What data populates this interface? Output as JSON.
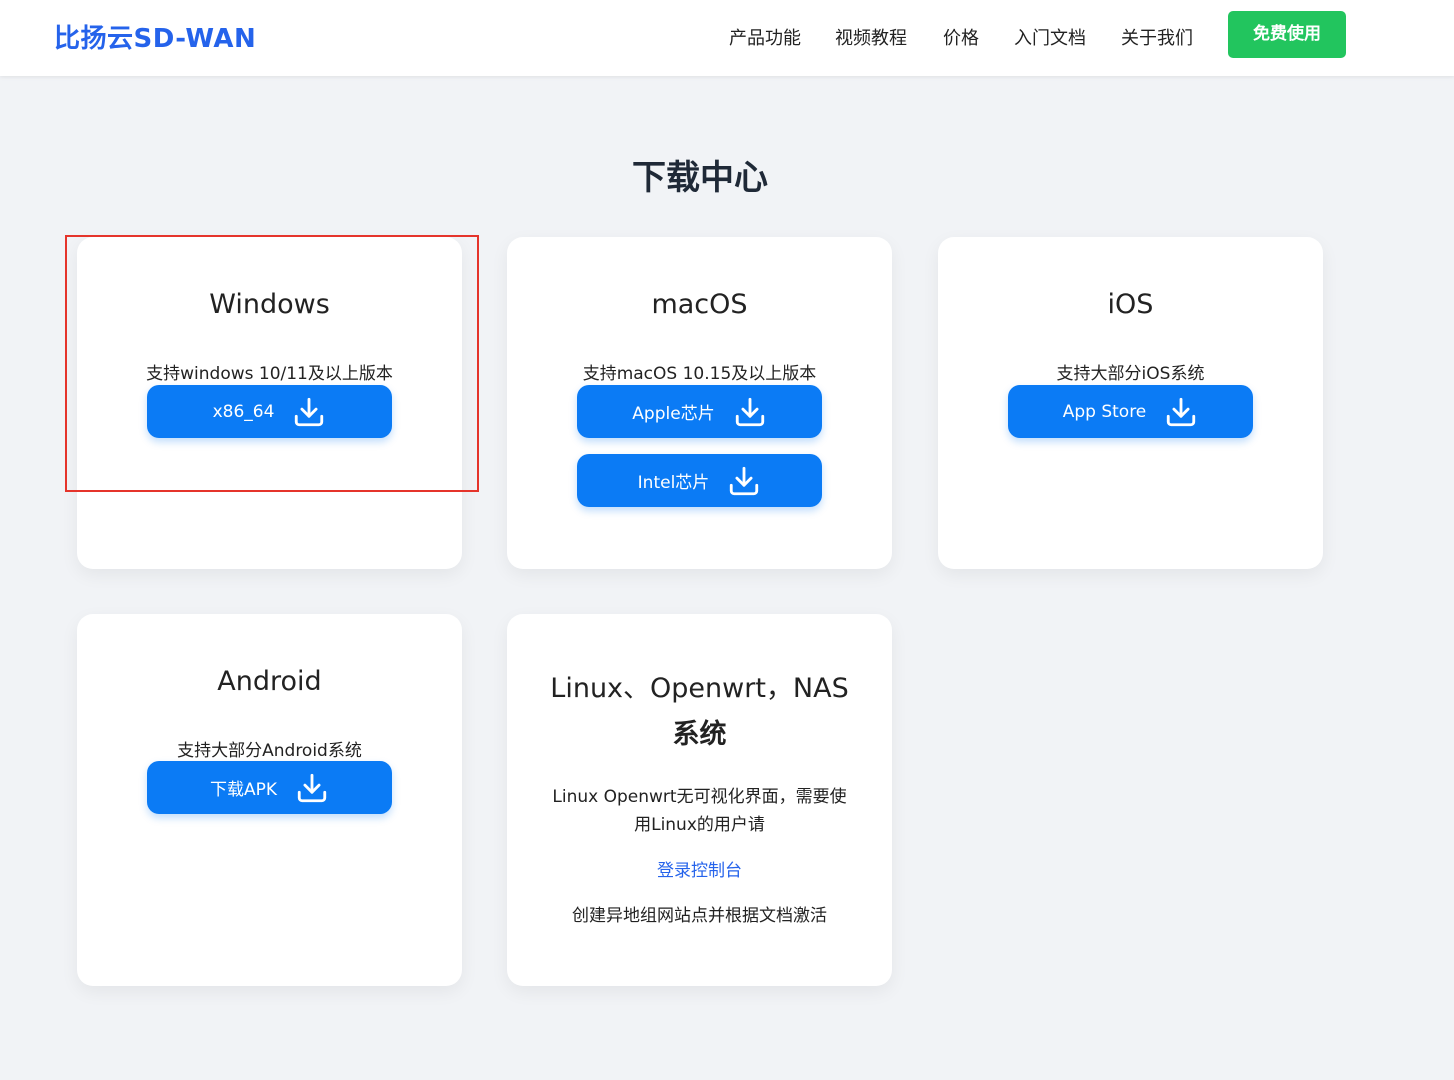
{
  "header": {
    "logo": "比扬云SD-WAN",
    "nav": [
      "产品功能",
      "视频教程",
      "价格",
      "入门文档",
      "关于我们"
    ],
    "cta": "免费使用"
  },
  "main": {
    "title": "下载中心",
    "cards": {
      "windows": {
        "title": "Windows",
        "desc": "支持windows 10/11及以上版本",
        "buttons": [
          "x86_64"
        ]
      },
      "macos": {
        "title": "macOS",
        "desc": "支持macOS 10.15及以上版本",
        "buttons": [
          "Apple芯片",
          "Intel芯片"
        ]
      },
      "ios": {
        "title": "iOS",
        "desc": "支持大部分iOS系统",
        "buttons": [
          "App Store"
        ]
      },
      "android": {
        "title": "Android",
        "desc": "支持大部分Android系统",
        "buttons": [
          "下载APK"
        ]
      },
      "linux": {
        "title_line1": "Linux、Openwrt，NAS",
        "title_line2": "系统",
        "desc_line1": "Linux Openwrt无可视化界面，需要使",
        "desc_line2": "用Linux的用户请",
        "link": "登录控制台",
        "note": "创建异地组网站点并根据文档激活"
      }
    }
  },
  "colors": {
    "accent": "#0b7bf5",
    "brand": "#2563eb",
    "cta": "#22c55e",
    "highlight": "#e5342b"
  },
  "icons": {
    "download": "download-icon"
  }
}
